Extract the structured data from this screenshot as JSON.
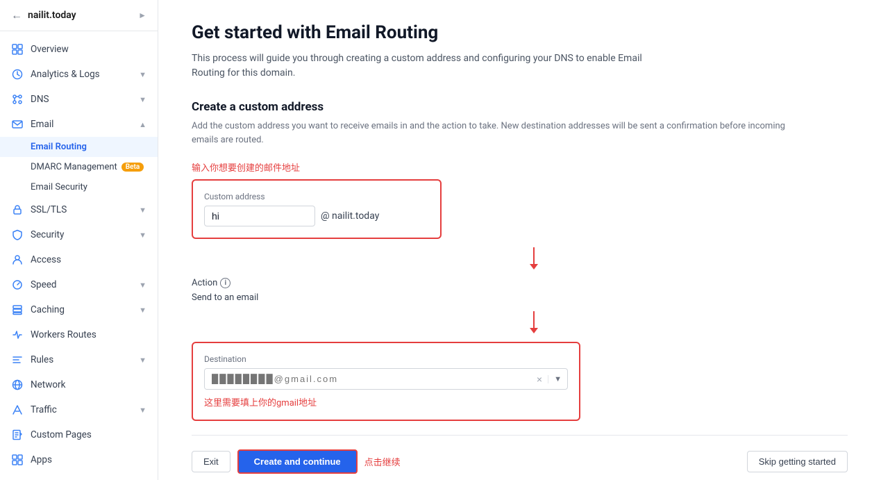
{
  "sidebar": {
    "site_name": "nailit.today",
    "items": [
      {
        "id": "overview",
        "label": "Overview",
        "icon": "grid",
        "expandable": false
      },
      {
        "id": "analytics-logs",
        "label": "Analytics & Logs",
        "icon": "chart",
        "expandable": true
      },
      {
        "id": "dns",
        "label": "DNS",
        "icon": "dns",
        "expandable": true
      },
      {
        "id": "email",
        "label": "Email",
        "icon": "email",
        "expandable": true,
        "expanded": true
      },
      {
        "id": "ssl-tls",
        "label": "SSL/TLS",
        "icon": "lock",
        "expandable": true
      },
      {
        "id": "security",
        "label": "Security",
        "icon": "shield",
        "expandable": true
      },
      {
        "id": "access",
        "label": "Access",
        "icon": "access",
        "expandable": false
      },
      {
        "id": "speed",
        "label": "Speed",
        "icon": "speed",
        "expandable": true
      },
      {
        "id": "caching",
        "label": "Caching",
        "icon": "cache",
        "expandable": true
      },
      {
        "id": "workers-routes",
        "label": "Workers Routes",
        "icon": "workers",
        "expandable": false
      },
      {
        "id": "rules",
        "label": "Rules",
        "icon": "rules",
        "expandable": true
      },
      {
        "id": "network",
        "label": "Network",
        "icon": "network",
        "expandable": false
      },
      {
        "id": "traffic",
        "label": "Traffic",
        "icon": "traffic",
        "expandable": true
      },
      {
        "id": "custom-pages",
        "label": "Custom Pages",
        "icon": "custom-pages",
        "expandable": false
      },
      {
        "id": "apps",
        "label": "Apps",
        "icon": "apps",
        "expandable": false
      }
    ],
    "email_subitems": [
      {
        "id": "email-routing",
        "label": "Email Routing",
        "active": true
      },
      {
        "id": "dmarc",
        "label": "DMARC Management",
        "badge": "Beta"
      },
      {
        "id": "email-security",
        "label": "Email Security"
      }
    ]
  },
  "main": {
    "title": "Get started with Email Routing",
    "subtitle": "This process will guide you through creating a custom address and configuring your DNS to enable Email Routing for this domain.",
    "section_title": "Create a custom address",
    "section_desc": "Add the custom address you want to receive emails in and the action to take. New destination addresses will be sent a confirmation before incoming emails are routed.",
    "annotation_address": "输入你想要创建的邮件地址",
    "custom_address_label": "Custom address",
    "custom_address_value": "hi",
    "domain": "@ nailit.today",
    "action_label": "Action",
    "action_value": "Send to an email",
    "destination_label": "Destination",
    "destination_placeholder": "████████@gmail.com",
    "annotation_destination": "这里需要填上你的gmail地址",
    "btn_exit": "Exit",
    "btn_create": "Create and continue",
    "click_hint": "点击继续",
    "btn_skip": "Skip getting started"
  }
}
